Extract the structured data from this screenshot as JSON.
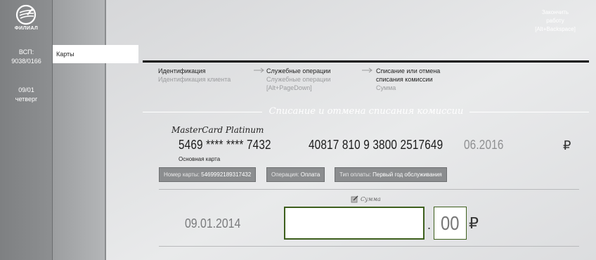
{
  "sidebar": {
    "logo_text": "ФИЛИАЛ",
    "branch_label": "ВСП:",
    "branch_code": "9038/0166",
    "date": "09/01",
    "weekday": "четверг"
  },
  "nav": {
    "active_item": "Карты"
  },
  "header": {
    "finish_line1": "Закончить",
    "finish_line2": "работу",
    "finish_shortcut": "[Alt+Backspace]"
  },
  "steps": [
    {
      "title": "Идентификация",
      "sub": "Идентификация клиента"
    },
    {
      "title": "Служебные операции",
      "sub": "Служебные операции",
      "sub2": "[Alt+PageDown]"
    },
    {
      "title_line1": "Списание или отмена",
      "title_line2": "списания комиссии",
      "sub": "Сумма"
    }
  ],
  "section_title": "Списание и отмена списания комиссии",
  "card": {
    "type": "MasterCard Platinum",
    "number": "5469 **** **** 7432",
    "account": "40817 810 9 3800 2517649",
    "expiry": "06.2016",
    "currency": "₽",
    "main_label": "Основная карта"
  },
  "tags": [
    {
      "label": "Номер карты:",
      "value": "5469992189317432"
    },
    {
      "label": "Операция:",
      "value": "Оплата"
    },
    {
      "label": "Тип оплаты:",
      "value": "Первый год обслуживания"
    }
  ],
  "amount": {
    "label": "Сумма",
    "date": "09.01.2014",
    "value": "",
    "separator": ".",
    "kopecks": "00",
    "currency": "₽"
  },
  "colors": {
    "input_border": "#3d5f1d",
    "sidebar": "#7e8082"
  }
}
